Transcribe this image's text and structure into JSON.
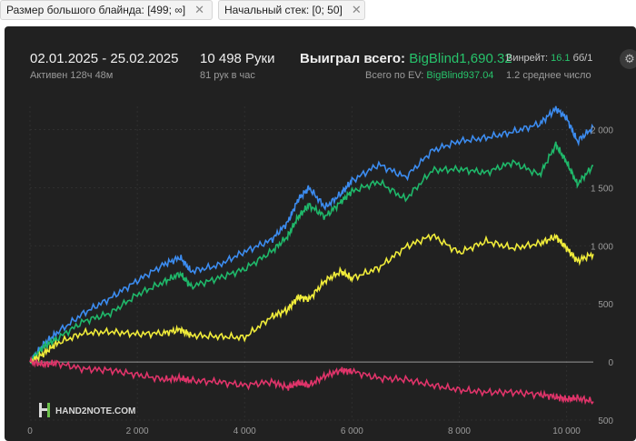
{
  "filters": [
    {
      "label": "Размер большого блайнда: [499; ∞]",
      "close": "✕"
    },
    {
      "label": "Начальный стек: [0; 50]",
      "close": "✕"
    }
  ],
  "stats": {
    "date_range": "02.01.2025 - 25.02.2025",
    "active_time": "Активен 128ч 48м",
    "hands": "10 498 Руки",
    "hands_per_hour": "81 рук в час",
    "won_total_label": "Выиграл всего:",
    "won_total_value": "BigBlind1,690.32",
    "ev_total_label": "Всего по EV:",
    "ev_total_value": "BigBlind937.04",
    "winrate_label": "Винрейт:",
    "winrate_value": "16.1",
    "winrate_unit": "бб/1",
    "average_note": "1.2 среднее число"
  },
  "watermark": "HAND2NOTE.COM",
  "colors": {
    "blue": "#3c8cf0",
    "green": "#1fb86a",
    "yellow": "#f0ec3a",
    "pink": "#e0346a",
    "panel": "#212121"
  },
  "icons": {
    "settings": "gear-icon",
    "logo": "hand2note-logo-icon"
  },
  "chart_data": {
    "type": "line",
    "xlim": [
      0,
      10498
    ],
    "ylim": [
      -500,
      2200
    ],
    "x_ticks": [
      "0",
      "2 000",
      "4 000",
      "6 000",
      "8 000",
      "10 000"
    ],
    "x_tick_values": [
      0,
      2000,
      4000,
      6000,
      8000,
      10000
    ],
    "y_ticks": [
      "2 000",
      "1 500",
      "1 000",
      "500",
      "0",
      "500"
    ],
    "y_tick_values": [
      2000,
      1500,
      1000,
      500,
      0,
      -500
    ],
    "x": [
      0,
      250,
      500,
      1000,
      1500,
      2000,
      2500,
      2800,
      3000,
      3500,
      4000,
      4500,
      4800,
      5000,
      5200,
      5500,
      5800,
      6000,
      6500,
      7000,
      7500,
      8000,
      8500,
      9000,
      9500,
      9800,
      10000,
      10200,
      10498
    ],
    "series": [
      {
        "color": "blue",
        "values": [
          0,
          150,
          250,
          420,
          550,
          700,
          840,
          900,
          780,
          830,
          950,
          1050,
          1200,
          1400,
          1500,
          1330,
          1450,
          1560,
          1700,
          1590,
          1820,
          1900,
          1930,
          1980,
          2050,
          2180,
          2100,
          1900,
          2020
        ]
      },
      {
        "color": "green",
        "values": [
          0,
          130,
          200,
          350,
          420,
          580,
          690,
          760,
          650,
          720,
          800,
          950,
          1080,
          1250,
          1350,
          1250,
          1380,
          1470,
          1550,
          1400,
          1650,
          1660,
          1630,
          1720,
          1610,
          1870,
          1720,
          1530,
          1690
        ]
      },
      {
        "color": "yellow",
        "values": [
          0,
          70,
          160,
          250,
          260,
          240,
          250,
          280,
          230,
          220,
          210,
          390,
          450,
          560,
          540,
          700,
          780,
          720,
          810,
          990,
          1090,
          940,
          1040,
          980,
          1020,
          1080,
          980,
          870,
          930
        ]
      },
      {
        "color": "pink",
        "values": [
          0,
          -20,
          -10,
          -60,
          -70,
          -110,
          -150,
          -140,
          -160,
          -170,
          -200,
          -170,
          -220,
          -180,
          -200,
          -120,
          -70,
          -80,
          -140,
          -150,
          -200,
          -240,
          -260,
          -260,
          -280,
          -300,
          -320,
          -310,
          -340
        ]
      }
    ]
  }
}
